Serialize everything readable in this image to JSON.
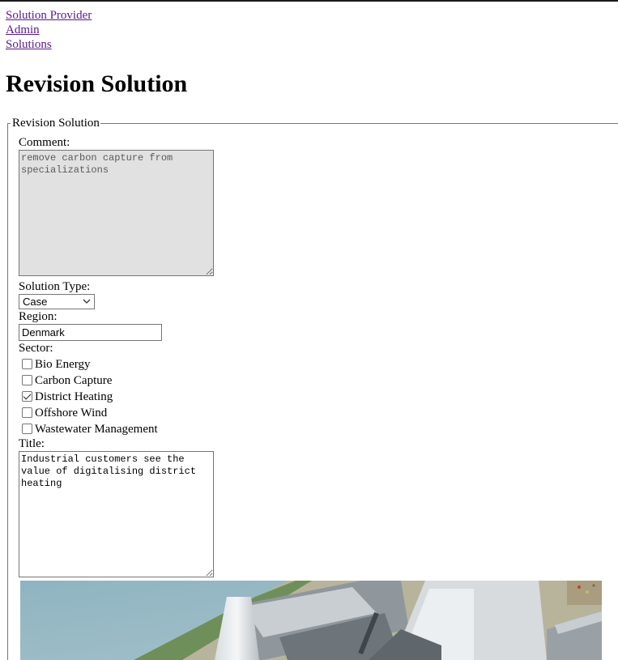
{
  "breadcrumbs": [
    "Solution Provider",
    "Admin",
    "Solutions"
  ],
  "page_title": "Revision Solution",
  "form": {
    "legend": "Revision Solution",
    "comment_label": "Comment:",
    "comment_value": "remove carbon capture from specializations",
    "solution_type_label": "Solution Type:",
    "solution_type_value": "Case",
    "region_label": "Region:",
    "region_value": "Denmark",
    "sector_label": "Sector:",
    "sectors": [
      {
        "label": "Bio Energy",
        "checked": false
      },
      {
        "label": "Carbon Capture",
        "checked": false
      },
      {
        "label": "District Heating",
        "checked": true
      },
      {
        "label": "Offshore Wind",
        "checked": false
      },
      {
        "label": "Wastewater Management",
        "checked": false
      }
    ],
    "title_label": "Title:",
    "title_value": "Industrial customers see the value of digitalising district heating"
  },
  "colors": {
    "link": "#551a8b",
    "disabled_field_bg": "#e1e1e1",
    "border": "#767676"
  },
  "icons": [
    "chevron-down-icon",
    "checkbox-checked-icon",
    "checkbox-unchecked-icon",
    "resize-grip-icon"
  ]
}
